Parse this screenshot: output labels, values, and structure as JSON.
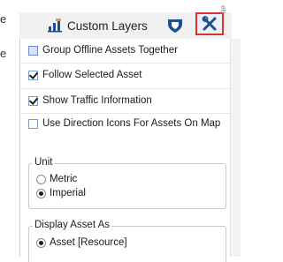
{
  "toolbar": {
    "layers_label": "Custom Layers",
    "vertical_label": "ets"
  },
  "snippet_left": [
    "e",
    "e"
  ],
  "options": [
    {
      "label": "Group Offline Assets Together",
      "checked": false
    },
    {
      "label": "Follow Selected Asset",
      "checked": true
    },
    {
      "label": "Show Traffic Information",
      "checked": true
    },
    {
      "label": "Use Direction Icons For Assets On Map",
      "checked": false
    }
  ],
  "unit_group": {
    "title": "Unit",
    "options": [
      {
        "label": "Metric",
        "selected": false
      },
      {
        "label": "Imperial",
        "selected": true
      }
    ]
  },
  "display_group": {
    "title": "Display Asset As",
    "options": [
      {
        "label": "Asset [Resource]",
        "selected": true
      }
    ]
  },
  "colors": {
    "highlight": "#e0302e",
    "accent": "#1f4e8c"
  }
}
